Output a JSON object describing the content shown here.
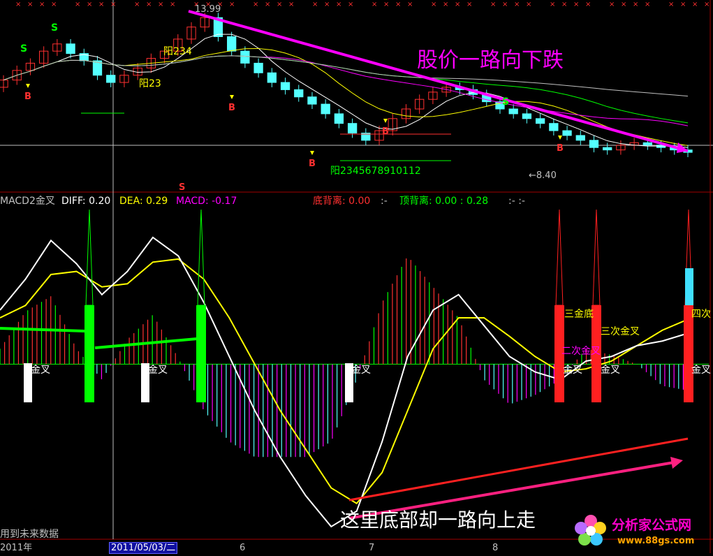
{
  "colors": {
    "background": "#000000",
    "up": "#ff3030",
    "down": "#54ffff",
    "diff": "#ffffff",
    "dea": "#ffff00",
    "macd": "#ff00ff",
    "magenta_line": "#ff00ff",
    "frame": "#a00000",
    "green": "#00ff00",
    "brand": "#ff00cc"
  },
  "price_panel": {
    "high_label": "13.99",
    "low_label": "←8.40",
    "headline": "股价一路向下跌",
    "yang_labels": [
      "阳234",
      "阳23"
    ],
    "count_label": "阳2345678910112",
    "signal_letters": [
      "S",
      "B"
    ]
  },
  "indicator_header": {
    "name": "MACD2金叉",
    "diff_label": "DIFF: 0.20",
    "dea_label": "DEA: 0.29",
    "macd_label": "MACD: -0.17",
    "bottom_div_label": "底背离: 0.00",
    "sep1": ":-",
    "top_div_label": "顶背离: 0.00 : 0.28",
    "sep2": ":- :-"
  },
  "indicator_panel": {
    "golden_cross": "金叉",
    "third_bottom": "三金底",
    "second_cross": "二次金叉",
    "third_cross": "三次金叉",
    "fourth_cross": "四次",
    "bottom_note": "这里底部却一路向上走",
    "future_data_note": "用到未来数据"
  },
  "time_axis": {
    "year": "2011年",
    "cursor_date": "2011/05/03/二",
    "months": [
      "6",
      "7",
      "8"
    ]
  },
  "watermark": {
    "brand": "分析家公式网",
    "url": "www.88gs.com"
  },
  "chart_data": [
    {
      "type": "candlestick",
      "title": "",
      "annotations": [
        "股价一路向下跌",
        "13.99",
        "8.40"
      ],
      "x_months": [
        "2011年",
        "6",
        "7",
        "8"
      ],
      "close": [
        11.4,
        11.8,
        12.1,
        12.6,
        12.9,
        12.5,
        12.2,
        11.6,
        11.3,
        11.6,
        11.9,
        12.3,
        12.6,
        13.1,
        13.6,
        13.99,
        13.2,
        12.6,
        12.1,
        11.7,
        11.3,
        11.0,
        10.7,
        10.4,
        10.0,
        9.6,
        9.2,
        8.9,
        9.3,
        9.8,
        10.2,
        10.6,
        10.9,
        11.1,
        11.0,
        10.8,
        10.5,
        10.2,
        10.0,
        9.8,
        9.6,
        9.3,
        9.1,
        8.9,
        8.6,
        8.5,
        8.7,
        8.8,
        8.7,
        8.6,
        8.5,
        8.4
      ]
    },
    {
      "type": "bar",
      "title": "MACD2金叉",
      "series": [
        {
          "name": "DIFF",
          "values": [
            0.35,
            0.55,
            0.8,
            0.65,
            0.45,
            0.6,
            0.82,
            0.7,
            0.4,
            0.05,
            -0.3,
            -0.6,
            -0.85,
            -1.05,
            -0.95,
            -0.5,
            0.05,
            0.35,
            0.45,
            0.25,
            0.05,
            -0.05,
            -0.1,
            0.02,
            0.05,
            0.12,
            0.15,
            0.2
          ]
        },
        {
          "name": "DEA",
          "values": [
            0.3,
            0.38,
            0.58,
            0.6,
            0.5,
            0.52,
            0.66,
            0.68,
            0.55,
            0.3,
            0.0,
            -0.3,
            -0.55,
            -0.8,
            -0.9,
            -0.7,
            -0.3,
            0.1,
            0.3,
            0.3,
            0.18,
            0.05,
            -0.05,
            -0.03,
            0.02,
            0.12,
            0.22,
            0.29
          ]
        },
        {
          "name": "MACD",
          "values": [
            0.1,
            0.34,
            0.44,
            0.1,
            -0.1,
            0.16,
            0.32,
            0.04,
            -0.3,
            -0.5,
            -0.6,
            -0.6,
            -0.6,
            -0.5,
            -0.1,
            0.4,
            0.7,
            0.5,
            0.3,
            -0.1,
            -0.26,
            -0.2,
            -0.1,
            0.1,
            0.06,
            0.0,
            -0.14,
            -0.17
          ]
        }
      ],
      "ylim": [
        -1.1,
        1.0
      ]
    }
  ]
}
